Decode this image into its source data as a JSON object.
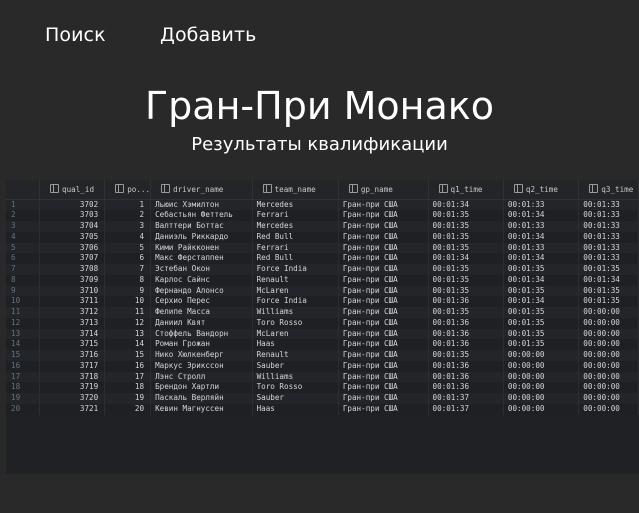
{
  "nav": {
    "search_label": "Поиск",
    "add_label": "Добавить"
  },
  "page": {
    "title": "Гран-При Монако",
    "subtitle": "Результаты квалификации"
  },
  "table": {
    "columns": [
      "qual_id",
      "ро...",
      "driver_name",
      "team_name",
      "gp_name",
      "q1_time",
      "q2_time",
      "q3_time"
    ],
    "rows": [
      [
        "1",
        "3702",
        "1",
        "Льюис Хэмилтон",
        "Mercedes",
        "Гран-при США",
        "00:01:34",
        "00:01:33",
        "00:01:33"
      ],
      [
        "2",
        "3703",
        "2",
        "Себастьян Феттель",
        "Ferrari",
        "Гран-при США",
        "00:01:35",
        "00:01:34",
        "00:01:33"
      ],
      [
        "3",
        "3704",
        "3",
        "Валттери Боттас",
        "Mercedes",
        "Гран-при США",
        "00:01:35",
        "00:01:33",
        "00:01:33"
      ],
      [
        "4",
        "3705",
        "4",
        "Даниэль Риккардо",
        "Red Bull",
        "Гран-при США",
        "00:01:35",
        "00:01:34",
        "00:01:33"
      ],
      [
        "5",
        "3706",
        "5",
        "Кими Райкконен",
        "Ferrari",
        "Гран-при США",
        "00:01:35",
        "00:01:33",
        "00:01:33"
      ],
      [
        "6",
        "3707",
        "6",
        "Макс Ферстаппен",
        "Red Bull",
        "Гран-при США",
        "00:01:34",
        "00:01:34",
        "00:01:33"
      ],
      [
        "7",
        "3708",
        "7",
        "Эстебан Окон",
        "Force India",
        "Гран-при США",
        "00:01:35",
        "00:01:35",
        "00:01:35"
      ],
      [
        "8",
        "3709",
        "8",
        "Карлос Сайнс",
        "Renault",
        "Гран-при США",
        "00:01:35",
        "00:01:34",
        "00:01:34"
      ],
      [
        "9",
        "3710",
        "9",
        "Фернандо Алонсо",
        "McLaren",
        "Гран-при США",
        "00:01:35",
        "00:01:35",
        "00:01:35"
      ],
      [
        "10",
        "3711",
        "10",
        "Серхио Перес",
        "Force India",
        "Гран-при США",
        "00:01:36",
        "00:01:34",
        "00:01:35"
      ],
      [
        "11",
        "3712",
        "11",
        "Фелипе Масса",
        "Williams",
        "Гран-при США",
        "00:01:35",
        "00:01:35",
        "00:00:00"
      ],
      [
        "12",
        "3713",
        "12",
        "Даниил Квят",
        "Toro Rosso",
        "Гран-при США",
        "00:01:36",
        "00:01:35",
        "00:00:00"
      ],
      [
        "13",
        "3714",
        "13",
        "Стоффель Вандорн",
        "McLaren",
        "Гран-при США",
        "00:01:36",
        "00:01:35",
        "00:00:00"
      ],
      [
        "14",
        "3715",
        "14",
        "Роман Грожан",
        "Haas",
        "Гран-при США",
        "00:01:36",
        "00:01:35",
        "00:00:00"
      ],
      [
        "15",
        "3716",
        "15",
        "Нико Хюлкенберг",
        "Renault",
        "Гран-при США",
        "00:01:35",
        "00:00:00",
        "00:00:00"
      ],
      [
        "16",
        "3717",
        "16",
        "Маркус Эрикссон",
        "Sauber",
        "Гран-при США",
        "00:01:36",
        "00:00:00",
        "00:00:00"
      ],
      [
        "17",
        "3718",
        "17",
        "Лэнс Стролл",
        "Williams",
        "Гран-при США",
        "00:01:36",
        "00:00:00",
        "00:00:00"
      ],
      [
        "18",
        "3719",
        "18",
        "Брендон Хартли",
        "Toro Rosso",
        "Гран-при США",
        "00:01:36",
        "00:00:00",
        "00:00:00"
      ],
      [
        "19",
        "3720",
        "19",
        "Паскаль Верляйн",
        "Sauber",
        "Гран-при США",
        "00:01:37",
        "00:00:00",
        "00:00:00"
      ],
      [
        "20",
        "3721",
        "20",
        "Кевин Магнуссен",
        "Haas",
        "Гран-при США",
        "00:01:37",
        "00:00:00",
        "00:00:00"
      ]
    ]
  }
}
